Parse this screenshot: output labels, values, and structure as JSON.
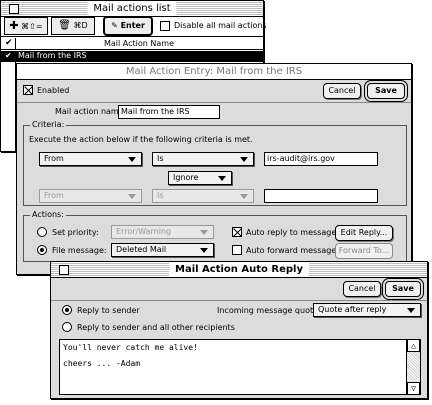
{
  "mail_actions_list": {
    "title": "Mail actions list",
    "toolbar": {
      "add_shortcut": "⌘⇧=",
      "delete_shortcut": "⌘D",
      "enter_label": "Enter",
      "disable_all_label": "Disable all mail actions"
    },
    "table": {
      "header": "Mail Action Name",
      "rows": [
        {
          "checked": true,
          "name": "Mail from the IRS"
        }
      ]
    }
  },
  "mail_action_entry": {
    "title": "Mail Action Entry: Mail from the IRS",
    "enabled_label": "Enabled",
    "cancel_label": "Cancel",
    "save_label": "Save",
    "name_label": "Mail action name:",
    "name_value": "Mail from the IRS",
    "criteria": {
      "group_title": "Criteria:",
      "description": "Execute the action below if the following criteria is met.",
      "row1": {
        "field": "From",
        "operator": "Is",
        "value": "irs-audit@irs.gov"
      },
      "ignore_label": "Ignore",
      "row2": {
        "field": "From",
        "operator": "Is",
        "value": ""
      }
    },
    "actions": {
      "group_title": "Actions:",
      "set_priority_label": "Set priority:",
      "priority_value": "Error/Warning",
      "file_message_label": "File message:",
      "file_value": "Deleted Mail",
      "auto_reply_label": "Auto reply to message",
      "edit_reply_label": "Edit Reply...",
      "auto_forward_label": "Auto forward message",
      "forward_to_label": "Forward To..."
    }
  },
  "auto_reply": {
    "title": "Mail Action Auto Reply",
    "cancel_label": "Cancel",
    "save_label": "Save",
    "reply_to_sender_label": "Reply to sender",
    "reply_all_label": "Reply to sender and all other recipients",
    "quoting_label": "Incoming message quoting:",
    "quoting_value": "Quote after reply",
    "body_line1": "You'll never catch me alive!",
    "body_line2": "cheers ... -Adam"
  }
}
